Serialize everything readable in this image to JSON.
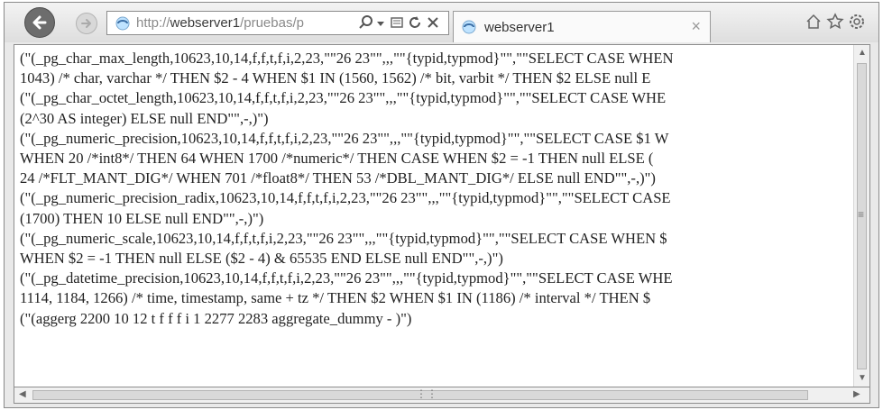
{
  "browser": {
    "address": {
      "url_prefix": "http://",
      "url_host": "webserver1",
      "url_path": "/pruebas/p"
    },
    "tab": {
      "title": "webserver1",
      "close_glyph": "×"
    }
  },
  "document": {
    "lines": [
      "(\"(_pg_char_max_length,10623,10,14,f,f,t,f,i,2,23,\"\"26 23\"\",,,\"\"{typid,typmod}\"\",\"\"SELECT CASE WHEN",
      "1043) /* char, varchar */ THEN $2 - 4 WHEN $1 IN (1560, 1562) /* bit, varbit */ THEN $2 ELSE null E",
      "(\"(_pg_char_octet_length,10623,10,14,f,f,t,f,i,2,23,\"\"26 23\"\",,,\"\"{typid,typmod}\"\",\"\"SELECT CASE WHE",
      "(2^30 AS integer) ELSE null END\"\",-,)\")",
      "(\"(_pg_numeric_precision,10623,10,14,f,f,t,f,i,2,23,\"\"26 23\"\",,,\"\"{typid,typmod}\"\",\"\"SELECT CASE $1 W",
      "WHEN 20 /*int8*/ THEN 64 WHEN 1700 /*numeric*/ THEN CASE WHEN $2 = -1 THEN null ELSE (",
      "24 /*FLT_MANT_DIG*/ WHEN 701 /*float8*/ THEN 53 /*DBL_MANT_DIG*/ ELSE null END\"\",-,)\")",
      "(\"(_pg_numeric_precision_radix,10623,10,14,f,f,t,f,i,2,23,\"\"26 23\"\",,,\"\"{typid,typmod}\"\",\"\"SELECT CASE",
      "(1700) THEN 10 ELSE null END\"\",-,)\")",
      "(\"(_pg_numeric_scale,10623,10,14,f,f,t,f,i,2,23,\"\"26 23\"\",,,\"\"{typid,typmod}\"\",\"\"SELECT CASE WHEN $",
      "WHEN $2 = -1 THEN null ELSE ($2 - 4) & 65535 END ELSE null END\"\",-,)\")",
      "(\"(_pg_datetime_precision,10623,10,14,f,f,t,f,i,2,23,\"\"26 23\"\",,,\"\"{typid,typmod}\"\",\"\"SELECT CASE WHE",
      "1114, 1184, 1266) /* time, timestamp, same + tz */ THEN $2 WHEN $1 IN (1186) /* interval */ THEN $",
      "(\"(aggerg 2200 10 12 t f f f i 1 2277 2283  aggregate_dummy - )\")"
    ]
  },
  "icons": {
    "back": "back-arrow-icon",
    "forward": "forward-arrow-icon",
    "site": "ie-page-icon",
    "search": "search-icon",
    "dropdown": "dropdown-arrow-icon",
    "compat": "compatibility-view-icon",
    "refresh": "refresh-icon",
    "stop": "stop-icon",
    "home": "home-icon",
    "favorites": "favorites-star-icon",
    "tools": "tools-gear-icon"
  }
}
